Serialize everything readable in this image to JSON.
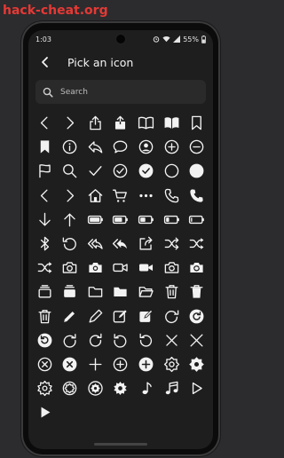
{
  "watermark": "hack-cheat.org",
  "status": {
    "time": "1:03",
    "battery": "55%"
  },
  "appbar": {
    "title": "Pick an icon"
  },
  "search": {
    "placeholder": "Search"
  },
  "icons": [
    "chevron-left",
    "chevron-right",
    "share-ios",
    "share-ios-filled",
    "book-open",
    "book-open-filled",
    "bookmark",
    "bookmark-filled",
    "info-circle",
    "reply",
    "chat-bubble",
    "user-circle",
    "plus-circle",
    "minus-circle",
    "flag",
    "search",
    "checkmark",
    "check-circle",
    "check-circle-filled",
    "circle",
    "circle-filled",
    "chevron-left",
    "chevron-right",
    "home",
    "cart",
    "ellipsis",
    "phone",
    "phone-filled",
    "arrow-down",
    "arrow-up",
    "battery-full",
    "battery-three-quarter",
    "battery-half",
    "battery-quarter",
    "battery-low",
    "bluetooth",
    "undo-circle",
    "reply-all",
    "reply-all-filled",
    "share-box",
    "shuffle",
    "shuffle-filled",
    "shuffle-alt",
    "camera",
    "camera-filled",
    "video",
    "video-filled",
    "camera-rotate",
    "camera-rotate-filled",
    "tray-stack",
    "tray-stack-filled",
    "folder",
    "folder-filled",
    "folder-open",
    "trash",
    "trash-filled",
    "trash-lines",
    "pencil",
    "pencil-alt",
    "edit-square",
    "edit-square-filled",
    "redo-circle",
    "redo-circle-filled",
    "refresh-circle-filled",
    "redo",
    "redo-alt",
    "undo",
    "undo-alt",
    "close",
    "close-alt",
    "close-circle",
    "close-circle-filled",
    "plus",
    "plus-circle",
    "plus-circle-filled",
    "gear",
    "gear-filled",
    "gear-outline",
    "gear-round",
    "gear-round-filled",
    "gear-small",
    "music-note",
    "music-notes",
    "play",
    "play-filled"
  ],
  "colors": {
    "background": "#1e1e1e",
    "icon": "#f2f2f2",
    "search_bg": "#2a2a2a",
    "watermark": "#e53935"
  }
}
